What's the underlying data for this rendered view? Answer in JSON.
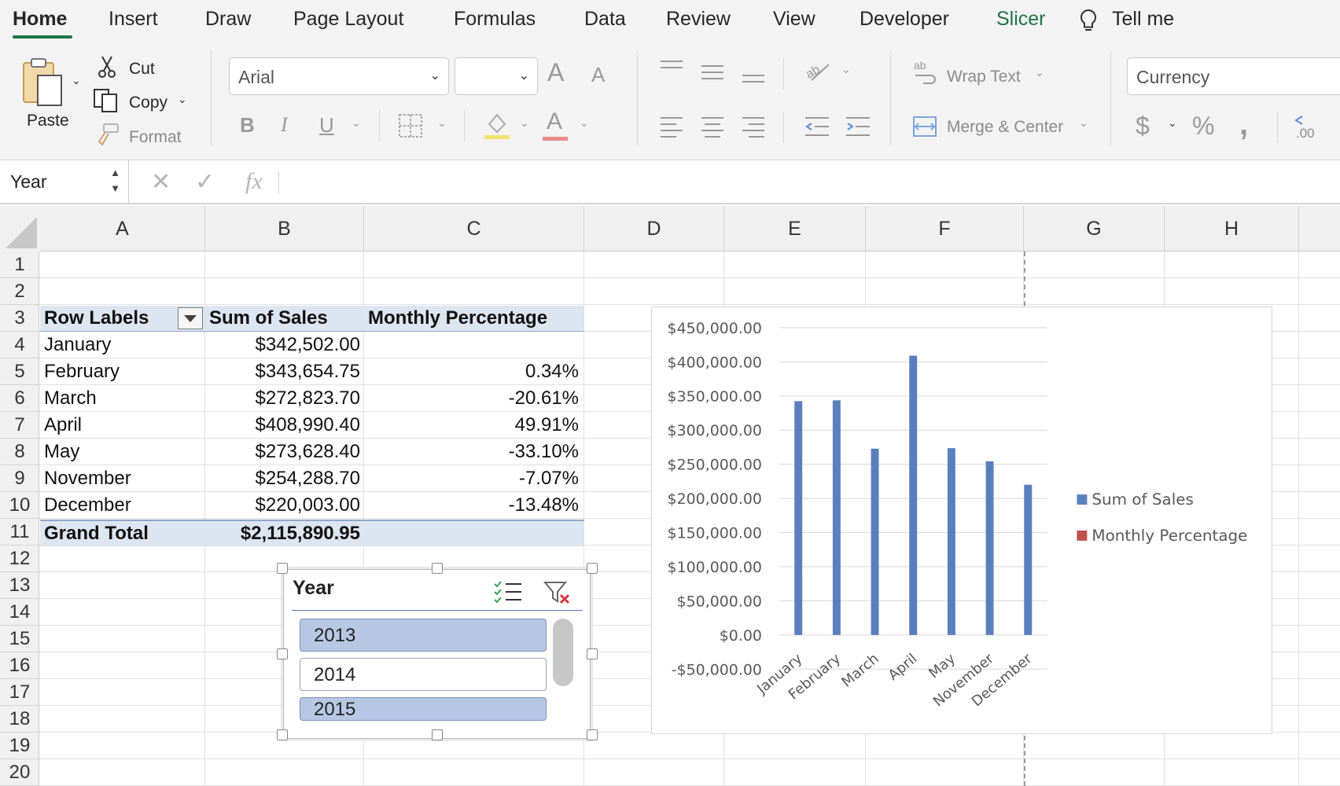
{
  "ribbon_tabs": {
    "home": "Home",
    "insert": "Insert",
    "draw": "Draw",
    "page_layout": "Page Layout",
    "formulas": "Formulas",
    "data": "Data",
    "review": "Review",
    "view": "View",
    "developer": "Developer",
    "slicer": "Slicer",
    "tell_me": "Tell me",
    "active": "Home"
  },
  "clipboard": {
    "paste": "Paste",
    "cut": "Cut",
    "copy": "Copy",
    "format": "Format"
  },
  "font": {
    "family": "Arial",
    "size": "",
    "bold": "B",
    "italic": "I",
    "underline": "U",
    "increase_size": "A",
    "decrease_size": "A",
    "font_color_letter": "A"
  },
  "alignment": {
    "wrap_text": "Wrap Text",
    "merge_center": "Merge & Center"
  },
  "number": {
    "format": "Currency",
    "currency_symbol": "$",
    "percent_symbol": "%",
    "comma_symbol": ",",
    "decimal_label": ".00"
  },
  "formula_bar": {
    "name_box": "Year",
    "fx": "fx",
    "cancel": "✕",
    "enter": "✓",
    "formula": ""
  },
  "sheet": {
    "columns": [
      "A",
      "B",
      "C",
      "D",
      "E",
      "F",
      "G",
      "H"
    ],
    "rows": [
      "1",
      "2",
      "3",
      "4",
      "5",
      "6",
      "7",
      "8",
      "9",
      "10",
      "11",
      "12",
      "13",
      "14",
      "15",
      "16",
      "17",
      "18",
      "19",
      "20"
    ],
    "pivot": {
      "headers": [
        "Row Labels",
        "Sum of Sales",
        "Monthly Percentage"
      ],
      "rows": [
        {
          "label": "January",
          "sales": "$342,502.00",
          "pct": ""
        },
        {
          "label": "February",
          "sales": "$343,654.75",
          "pct": "0.34%"
        },
        {
          "label": "March",
          "sales": "$272,823.70",
          "pct": "-20.61%"
        },
        {
          "label": "April",
          "sales": "$408,990.40",
          "pct": "49.91%"
        },
        {
          "label": "May",
          "sales": "$273,628.40",
          "pct": "-33.10%"
        },
        {
          "label": "November",
          "sales": "$254,288.70",
          "pct": "-7.07%"
        },
        {
          "label": "December",
          "sales": "$220,003.00",
          "pct": "-13.48%"
        }
      ],
      "total": {
        "label": "Grand Total",
        "sales": "$2,115,890.95",
        "pct": ""
      }
    }
  },
  "slicer": {
    "title": "Year",
    "items": [
      {
        "label": "2013",
        "selected": true
      },
      {
        "label": "2014",
        "selected": false
      },
      {
        "label": "2015",
        "selected": true
      }
    ]
  },
  "colors": {
    "accent_green": "#217346",
    "bar_blue": "#5b7fbd",
    "legend_red": "#c0504d",
    "pivot_band": "#dce5f0",
    "slicer_selected": "#b8c8e4"
  },
  "chart_data": {
    "type": "bar",
    "categories": [
      "January",
      "February",
      "March",
      "April",
      "May",
      "November",
      "December"
    ],
    "series": [
      {
        "name": "Sum of Sales",
        "values": [
          342502.0,
          343654.75,
          272823.7,
          408990.4,
          273628.4,
          254288.7,
          220003.0
        ],
        "color": "#5b7fbd"
      },
      {
        "name": "Monthly Percentage",
        "values": [
          null,
          0.0034,
          -0.2061,
          0.4991,
          -0.331,
          -0.0707,
          -0.1348
        ],
        "color": "#c0504d"
      }
    ],
    "y_tick_labels": [
      "$450,000.00",
      "$400,000.00",
      "$350,000.00",
      "$300,000.00",
      "$250,000.00",
      "$200,000.00",
      "$150,000.00",
      "$100,000.00",
      "$50,000.00",
      "$0.00",
      "-$50,000.00"
    ],
    "ylim": [
      -50000,
      450000
    ],
    "title": "",
    "xlabel": "",
    "ylabel": "",
    "grid": true,
    "legend_position": "right"
  }
}
